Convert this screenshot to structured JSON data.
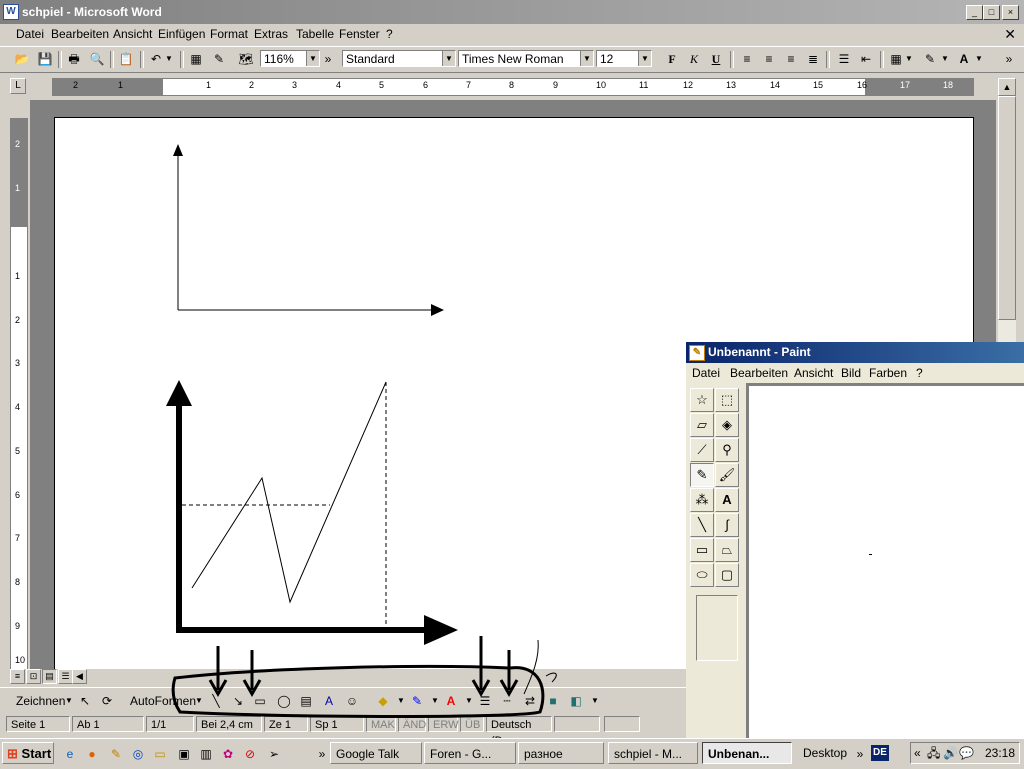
{
  "word": {
    "title": "schpiel - Microsoft Word",
    "app_icon": "W",
    "menu": [
      "Datei",
      "Bearbeiten",
      "Ansicht",
      "Einfügen",
      "Format",
      "Extras",
      "Tabelle",
      "Fenster",
      "?"
    ],
    "toolbar": {
      "zoom": "116%",
      "style": "Standard",
      "font": "Times New Roman",
      "size": "12",
      "bold": "F",
      "italic": "K",
      "underline": "U"
    },
    "ruler_h": [
      "2",
      "1",
      "1",
      "2",
      "3",
      "4",
      "5",
      "6",
      "7",
      "8",
      "9",
      "10",
      "11",
      "12",
      "13",
      "14",
      "15",
      "16",
      "17",
      "18"
    ],
    "ruler_v": [
      "2",
      "1",
      "1",
      "2",
      "3",
      "4",
      "5",
      "6",
      "7",
      "8",
      "9",
      "10"
    ],
    "drawing_toolbar": {
      "draw_label": "Zeichnen",
      "autoshapes_label": "AutoFormen"
    },
    "status": {
      "page": "Seite 1",
      "section": "Ab 1",
      "pages": "1/1",
      "position": "Bei 2,4 cm",
      "line": "Ze 1",
      "column": "Sp 1",
      "rec": "MAK",
      "trk": "ÄND",
      "ext": "ERW",
      "ovr": "ÜB",
      "language": "Deutsch (De"
    }
  },
  "paint": {
    "title": "Unbenannt - Paint",
    "menu": [
      "Datei",
      "Bearbeiten",
      "Ansicht",
      "Bild",
      "Farben",
      "?"
    ]
  },
  "taskbar": {
    "start": "Start",
    "tasks": [
      "Google Talk",
      "Foren - G...",
      "разное",
      "schpiel - M...",
      "Unbenan..."
    ],
    "desktop": "Desktop",
    "lang": "DE",
    "clock": "23:18"
  },
  "colors": {
    "word_title_inactive": "#808080",
    "paint_title_active": "#0a246a",
    "highlight_yellow": "#ffff00",
    "line_blue": "#0000ff",
    "font_red": "#ff0000"
  }
}
